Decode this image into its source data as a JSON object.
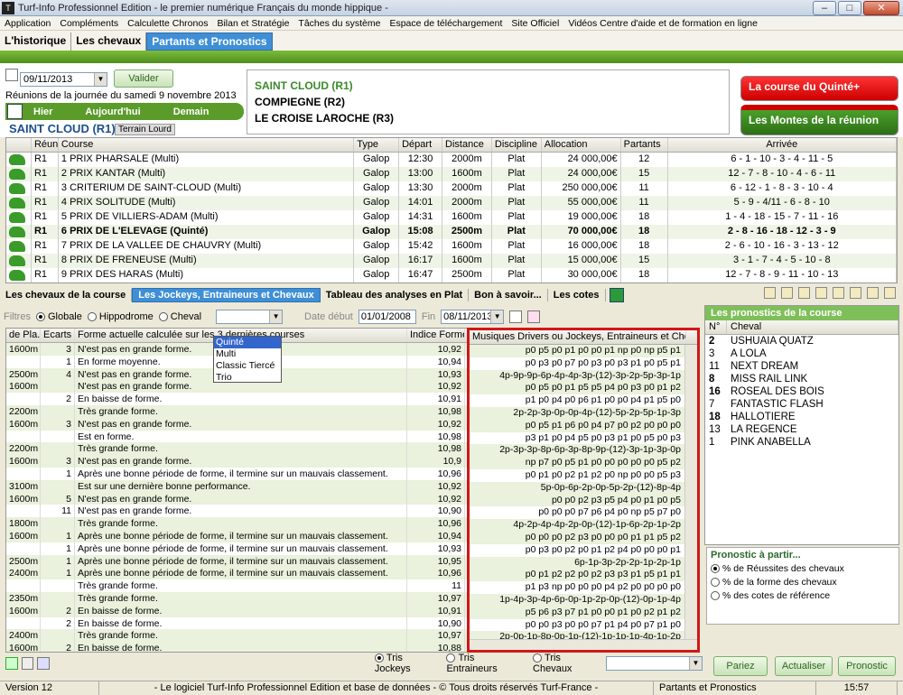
{
  "window": {
    "title": "Turf-Info Professionnel Edition - le premier numérique Français du monde hippique -"
  },
  "menu": [
    "Application",
    "Compléments",
    "Calculette Chronos",
    "Bilan et Stratégie",
    "Tâches du système",
    "Espace de téléchargement",
    "Site Officiel",
    "Vidéos Centre d'aide et de formation en ligne"
  ],
  "tabs": [
    "L'historique",
    "Les chevaux",
    "Partants et Pronostics"
  ],
  "date": "09/11/2013",
  "valider": "Valider",
  "reunions_line": "Réunions de la journée du samedi 9 novembre 2013",
  "day_nav": [
    "Hier",
    "Aujourd'hui",
    "Demain"
  ],
  "hippodrome": "SAINT CLOUD (R1)",
  "terrain": "Terrain Lourd",
  "meetings": [
    "SAINT CLOUD (R1)",
    "COMPIEGNE (R2)",
    "LE CROISE LAROCHE (R3)"
  ],
  "btn_quinte": "La course du Quinté+",
  "btn_montes": "Les Montes de la réunion",
  "race_headers": [
    "Réunion",
    "Course",
    "Type",
    "Départ",
    "Distance",
    "Discipline",
    "Allocation",
    "Partants",
    "Arrivée"
  ],
  "races": [
    [
      "R1",
      "1 PRIX PHARSALE (Multi)",
      "Galop",
      "12:30",
      "2000m",
      "Plat",
      "24 000,00€",
      "12",
      "6 - 1 - 10 - 3 - 4 - 11 - 5"
    ],
    [
      "R1",
      "2 PRIX KANTAR (Multi)",
      "Galop",
      "13:00",
      "1600m",
      "Plat",
      "24 000,00€",
      "15",
      "12 - 7 - 8 - 10 - 4 - 6 - 11"
    ],
    [
      "R1",
      "3 CRITERIUM DE SAINT-CLOUD (Multi)",
      "Galop",
      "13:30",
      "2000m",
      "Plat",
      "250 000,00€",
      "11",
      "6 - 12 - 1 - 8 - 3 - 10 - 4"
    ],
    [
      "R1",
      "4 PRIX SOLITUDE (Multi)",
      "Galop",
      "14:01",
      "2000m",
      "Plat",
      "55 000,00€",
      "11",
      "5 - 9 - 4/11 - 6 - 8 - 10"
    ],
    [
      "R1",
      "5 PRIX DE VILLIERS-ADAM (Multi)",
      "Galop",
      "14:31",
      "1600m",
      "Plat",
      "19 000,00€",
      "18",
      "1 - 4 - 18 - 15 - 7 - 11 - 16"
    ],
    [
      "R1",
      "6 PRIX DE L'ELEVAGE (Quinté)",
      "Galop",
      "15:08",
      "2500m",
      "Plat",
      "70 000,00€",
      "18",
      "2 - 8 - 16 - 18 - 12 - 3 - 9"
    ],
    [
      "R1",
      "7 PRIX DE LA VALLEE DE CHAUVRY (Multi)",
      "Galop",
      "15:42",
      "1600m",
      "Plat",
      "16 000,00€",
      "18",
      "2 - 6 - 10 - 16 - 3 - 13 - 12"
    ],
    [
      "R1",
      "8 PRIX DE FRENEUSE (Multi)",
      "Galop",
      "16:17",
      "1600m",
      "Plat",
      "15 000,00€",
      "15",
      "3 - 1 - 7 - 4 - 5 - 10 - 8"
    ],
    [
      "R1",
      "9 PRIX DES HARAS (Multi)",
      "Galop",
      "16:47",
      "2500m",
      "Plat",
      "30 000,00€",
      "18",
      "12 - 7 - 8 - 9 - 11 - 10 - 13"
    ]
  ],
  "subtabs": [
    "Les chevaux de la course",
    "Les Jockeys, Entraineurs et Chevaux",
    "Tableau des analyses en Plat",
    "Bon à savoir...",
    "Les cotes"
  ],
  "filters": {
    "label": "Filtres",
    "opts": [
      "Globale",
      "Hippodrome",
      "Cheval"
    ],
    "date_debut_label": "Date début",
    "date_debut": "01/01/2008",
    "fin_label": "Fin",
    "fin": "08/11/2013"
  },
  "dropdown": [
    "Quinté",
    "Multi",
    "Classic Tiercé",
    "Trio"
  ],
  "main_headers": [
    "de Pla.",
    "Ecarts",
    "Forme actuelle calculée sur les 3 dernières courses",
    "Indice Forme"
  ],
  "mus_header": "Musiques Drivers ou Jockeys, Entraineurs et Cheval",
  "rows": [
    [
      "1600m",
      "3",
      "N'est pas en grande forme.",
      "10,92",
      "p0 p5 p0 p1 p0 p0 p1 np p0 np p5 p1"
    ],
    [
      "",
      "1",
      "En forme moyenne.",
      "10,94",
      "p0 p3 p0 p7 p0 p3 p0 p3 p1 p0 p5 p1"
    ],
    [
      "2500m",
      "4",
      "N'est pas en grande forme.",
      "10,93",
      "4p-9p-9p-6p-4p-4p-3p-(12)-3p-2p-5p-3p-1p"
    ],
    [
      "1600m",
      "",
      "N'est pas en grande forme.",
      "10,92",
      "p0 p5 p0 p1 p5 p5 p4 p0 p3 p0 p1 p2"
    ],
    [
      "",
      "2",
      "En baisse de forme.",
      "10,91",
      "p1 p0 p4 p0 p6 p1 p0 p0 p4 p1 p5 p0"
    ],
    [
      "2200m",
      "",
      "Très grande forme.",
      "10,98",
      "2p-2p-3p-0p-0p-4p-(12)-5p-2p-5p-1p-3p"
    ],
    [
      "1600m",
      "3",
      "N'est pas en grande forme.",
      "10,92",
      "p0 p5 p1 p6 p0 p4 p7 p0 p2 p0 p0 p0"
    ],
    [
      "",
      "",
      "Est en forme.",
      "10,98",
      "p3 p1 p0 p4 p5 p0 p3 p1 p0 p5 p0 p3"
    ],
    [
      "2200m",
      "",
      "Très grande forme.",
      "10,98",
      "2p-3p-3p-8p-6p-3p-8p-9p-(12)-3p-1p-3p-0p"
    ],
    [
      "1600m",
      "3",
      "N'est pas en grande forme.",
      "10,9",
      "np p7 p0 p5 p1 p0 p0 p0 p0 p0 p5 p2"
    ],
    [
      "",
      "1",
      "Après une bonne période de forme, il termine sur un mauvais classement.",
      "10,96",
      "p0 p1 p0 p2 p1 p2 p0 np p0 p0 p5 p3"
    ],
    [
      "3100m",
      "",
      "Est sur une dernière bonne performance.",
      "10,92",
      "5p-0p-6p-2p-0p-5p-2p-(12)-8p-4p"
    ],
    [
      "1600m",
      "5",
      "N'est pas en grande forme.",
      "10,92",
      "p0 p0 p2 p3 p5 p4 p0 p1 p0 p5"
    ],
    [
      "",
      "11",
      "N'est pas en grande forme.",
      "10,90",
      "p0 p0 p0 p7 p6 p4 p0 np p5 p7 p0"
    ],
    [
      "1800m",
      "",
      "Très grande forme.",
      "10,96",
      "4p-2p-4p-4p-2p-0p-(12)-1p-6p-2p-1p-2p"
    ],
    [
      "1600m",
      "1",
      "Après une bonne période de forme, il termine sur un mauvais classement.",
      "10,94",
      "p0 p0 p0 p2 p3 p0 p0 p0 p1 p1 p5 p2"
    ],
    [
      "",
      "1",
      "Après une bonne période de forme, il termine sur un mauvais classement.",
      "10,93",
      "p0 p3 p0 p2 p0 p1 p2 p4 p0 p0 p0 p1"
    ],
    [
      "2500m",
      "1",
      "Après une bonne période de forme, il termine sur un mauvais classement.",
      "10,95",
      "6p-1p-3p-2p-2p-1p-2p-1p"
    ],
    [
      "2400m",
      "1",
      "Après une bonne période de forme, il termine sur un mauvais classement.",
      "10,96",
      "p0 p1 p2 p2 p0 p2 p3 p3 p1 p5 p1 p1"
    ],
    [
      "",
      "",
      "Très grande forme.",
      "11",
      "p1 p3 np p0 p0 p0 p4 p2 p0 p0 p0 p0"
    ],
    [
      "2350m",
      "",
      "Très grande forme.",
      "10,97",
      "1p-4p-3p-4p-6p-0p-1p-2p-0p-(12)-0p-1p-4p"
    ],
    [
      "1600m",
      "2",
      "En baisse de forme.",
      "10,91",
      "p5 p6 p3 p7 p1 p0 p0 p1 p0 p2 p1 p2"
    ],
    [
      "",
      "2",
      "En baisse de forme.",
      "10,90",
      "p0 p0 p3 p0 p0 p7 p1 p4 p0 p7 p1 p0"
    ],
    [
      "2400m",
      "",
      "Très grande forme.",
      "10,97",
      "2p-0p-1p-8p-0p-1p-(12)-1p-1p-1p-4p-1p-2p"
    ],
    [
      "1600m",
      "2",
      "En baisse de forme.",
      "10,88",
      "p0 p0 p0 p0 p0 p1 p0 p0 p0 p5 p2 p1"
    ]
  ],
  "sort": {
    "opts": [
      "Tris Jockeys",
      "Tris Entraineurs",
      "Tris Chevaux"
    ]
  },
  "prono": {
    "title": "Les pronostics de la course",
    "headers": [
      "N°",
      "Cheval"
    ],
    "items": [
      [
        "2",
        "USHUAIA QUATZ",
        true
      ],
      [
        "3",
        "A LOLA",
        false
      ],
      [
        "11",
        "NEXT DREAM",
        false
      ],
      [
        "8",
        "MISS RAIL LINK",
        true
      ],
      [
        "16",
        "ROSEAL DES BOIS",
        true
      ],
      [
        "7",
        "FANTASTIC FLASH",
        false
      ],
      [
        "18",
        "HALLOTIERE",
        true
      ],
      [
        "13",
        "LA REGENCE",
        false
      ],
      [
        "1",
        "PINK ANABELLA",
        false
      ]
    ]
  },
  "prono_from": {
    "title": "Pronostic à partir...",
    "opts": [
      "% de Réussites des chevaux",
      "% de la forme des chevaux",
      "% des cotes de référence"
    ]
  },
  "buttons": {
    "pariez": "Pariez",
    "actualiser": "Actualiser",
    "pronostic": "Pronostic"
  },
  "status": {
    "version": "Version 12",
    "copyright": "- Le logiciel Turf-Info Professionnel Edition et base de données - © Tous droits réservés Turf-France -",
    "section": "Partants et Pronostics",
    "time": "15:57"
  }
}
